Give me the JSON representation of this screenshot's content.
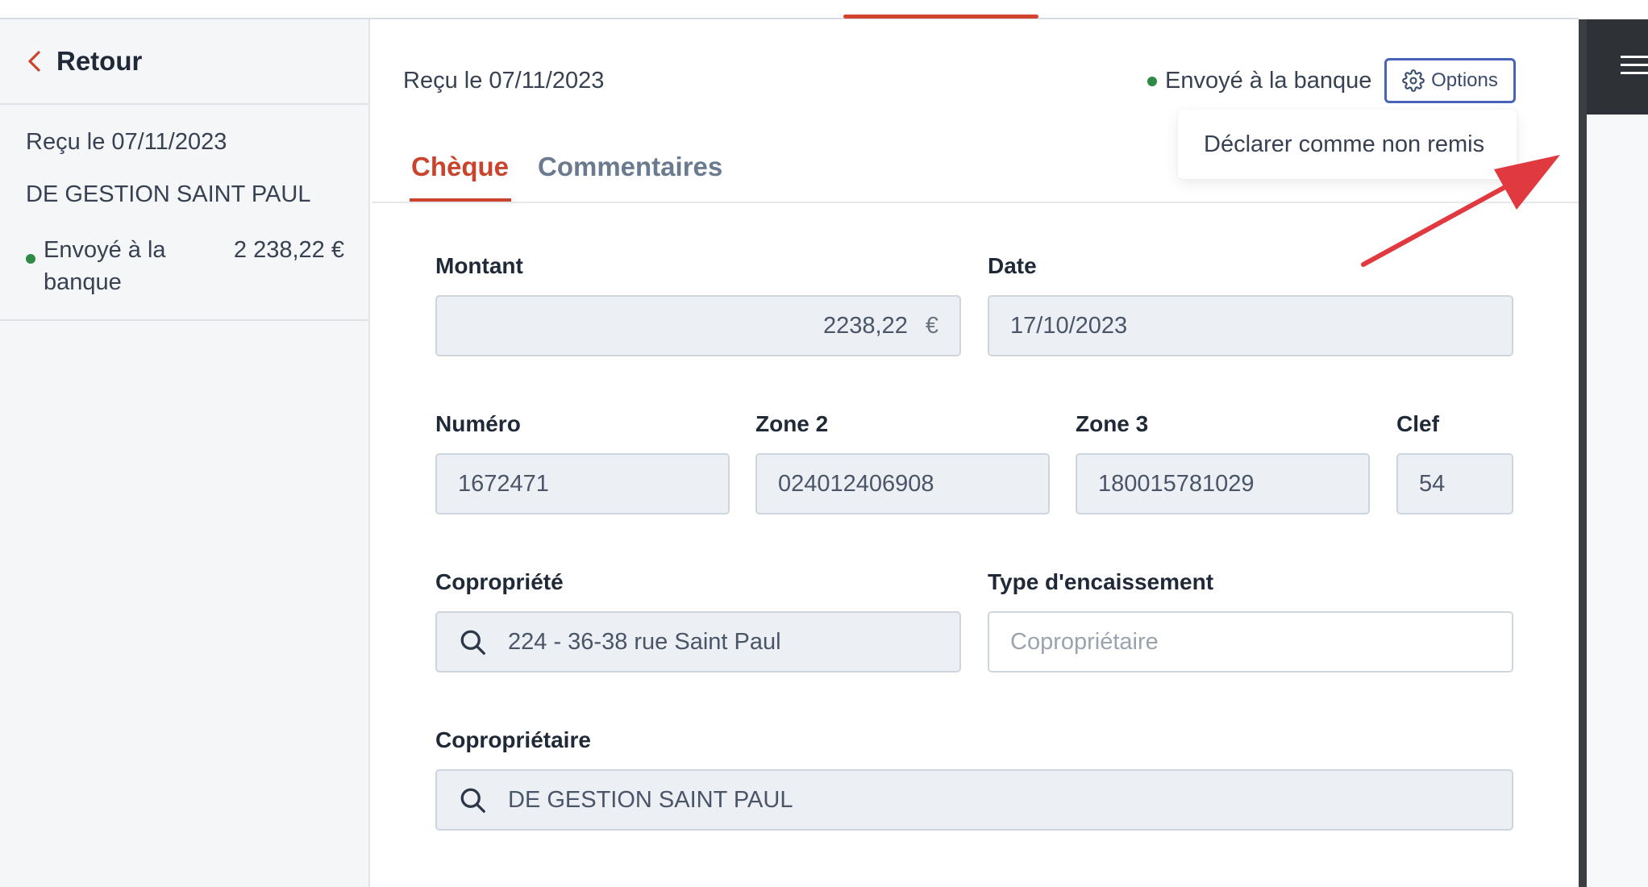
{
  "sidebar": {
    "back_label": "Retour",
    "card": {
      "received": "Reçu le 07/11/2023",
      "name": "DE GESTION SAINT PAUL",
      "status": "Envoyé à la banque",
      "amount": "2 238,22 €"
    }
  },
  "header": {
    "received": "Reçu le 07/11/2023",
    "status": "Envoyé à la banque",
    "options_label": "Options",
    "dropdown_item": "Déclarer comme non remis"
  },
  "tabs": [
    {
      "label": "Chèque",
      "active": true
    },
    {
      "label": "Commentaires",
      "active": false
    }
  ],
  "form": {
    "montant": {
      "label": "Montant",
      "value": "2238,22",
      "currency": "€"
    },
    "date": {
      "label": "Date",
      "value": "17/10/2023"
    },
    "numero": {
      "label": "Numéro",
      "value": "1672471"
    },
    "zone2": {
      "label": "Zone 2",
      "value": "024012406908"
    },
    "zone3": {
      "label": "Zone 3",
      "value": "180015781029"
    },
    "clef": {
      "label": "Clef",
      "value": "54"
    },
    "copropriete": {
      "label": "Copropriété",
      "value": "224 - 36-38 rue Saint Paul"
    },
    "type_encaissement": {
      "label": "Type d'encaissement",
      "placeholder": "Copropriétaire"
    },
    "coproprietaire": {
      "label": "Copropriétaire",
      "value": "DE GESTION SAINT PAUL"
    }
  },
  "colors": {
    "accent_red": "#c9432d",
    "status_green": "#2f8a45",
    "options_border": "#4764b8",
    "annotation_arrow": "#e0393f"
  },
  "icons": [
    "chevron-left-icon",
    "gear-icon",
    "search-icon",
    "hamburger-menu-icon",
    "annotation-arrow"
  ]
}
